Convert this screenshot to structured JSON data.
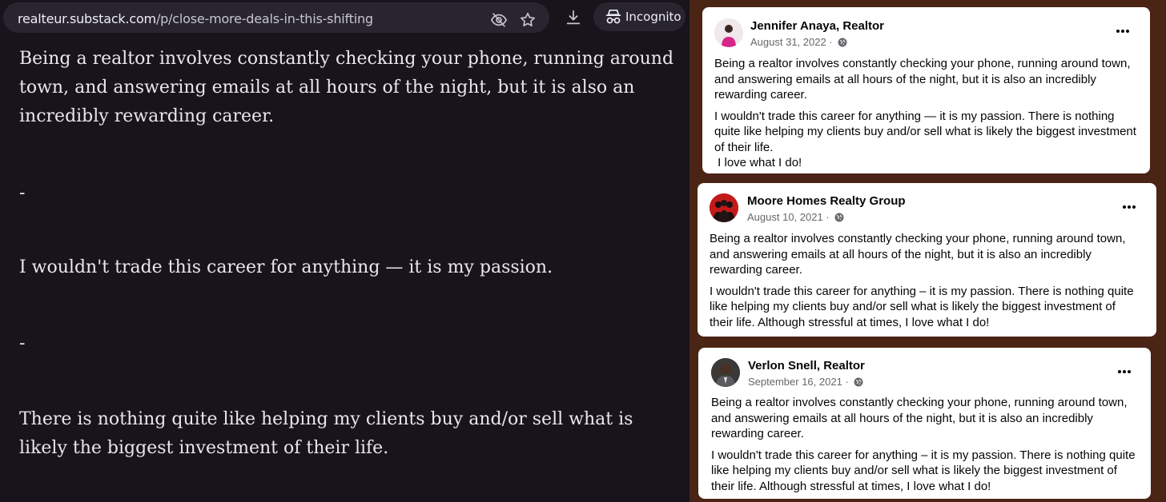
{
  "browser": {
    "url_host": "realteur.substack.com",
    "url_path": "/p/close-more-deals-in-this-shifting",
    "incognito_label": "Incognito",
    "icons": [
      "eye-slash-icon",
      "star-icon",
      "download-icon",
      "incognito-icon"
    ]
  },
  "article": {
    "paragraphs": [
      "Being a realtor involves constantly checking your phone, running around town, and answering emails at all hours of the night, but it is also an incredibly rewarding career.",
      "-",
      "I wouldn't trade this career for anything — it is my passion.",
      "-",
      "There is nothing quite like helping my clients buy and/or sell what is likely the biggest investment of their life."
    ]
  },
  "posts": [
    {
      "author": "Jennifer Anaya, Realtor",
      "date": "August 31, 2022 ·",
      "paragraphs": [
        "Being a realtor involves constantly checking your phone, running around town, and answering emails at all hours of the night, but it is also an incredibly rewarding career.",
        "I wouldn't trade this career for anything — it is my passion. There is nothing quite like helping my clients buy and/or sell what is likely the biggest investment of their life.",
        " I love what I do!"
      ]
    },
    {
      "author": "Moore Homes Realty Group",
      "date": "August 10, 2021 ·",
      "paragraphs": [
        "Being a realtor involves constantly checking your phone, running around town, and answering emails at all hours of the night, but it is also an incredibly rewarding career.",
        "I wouldn't trade this career for anything – it is my passion. There is nothing quite like helping my clients buy and/or sell what is likely the biggest investment of their life. Although stressful at times, I love what I do!"
      ]
    },
    {
      "author": "Verlon Snell, Realtor",
      "date": "September 16, 2021 ·",
      "paragraphs": [
        "Being a realtor involves constantly checking your phone, running around town, and answering emails at all hours of the night, but it is also an incredibly rewarding career.",
        "I wouldn't trade this career for anything – it is my passion. There is nothing quite like helping my clients buy and/or sell what is likely the biggest investment of their life. Although stressful at times, I love what I do!"
      ]
    }
  ],
  "colors": {
    "browser_bg": "#17141c",
    "article_text": "#e9e6ee",
    "post_meta": "#65676b",
    "panel_border": "#4a2414"
  }
}
